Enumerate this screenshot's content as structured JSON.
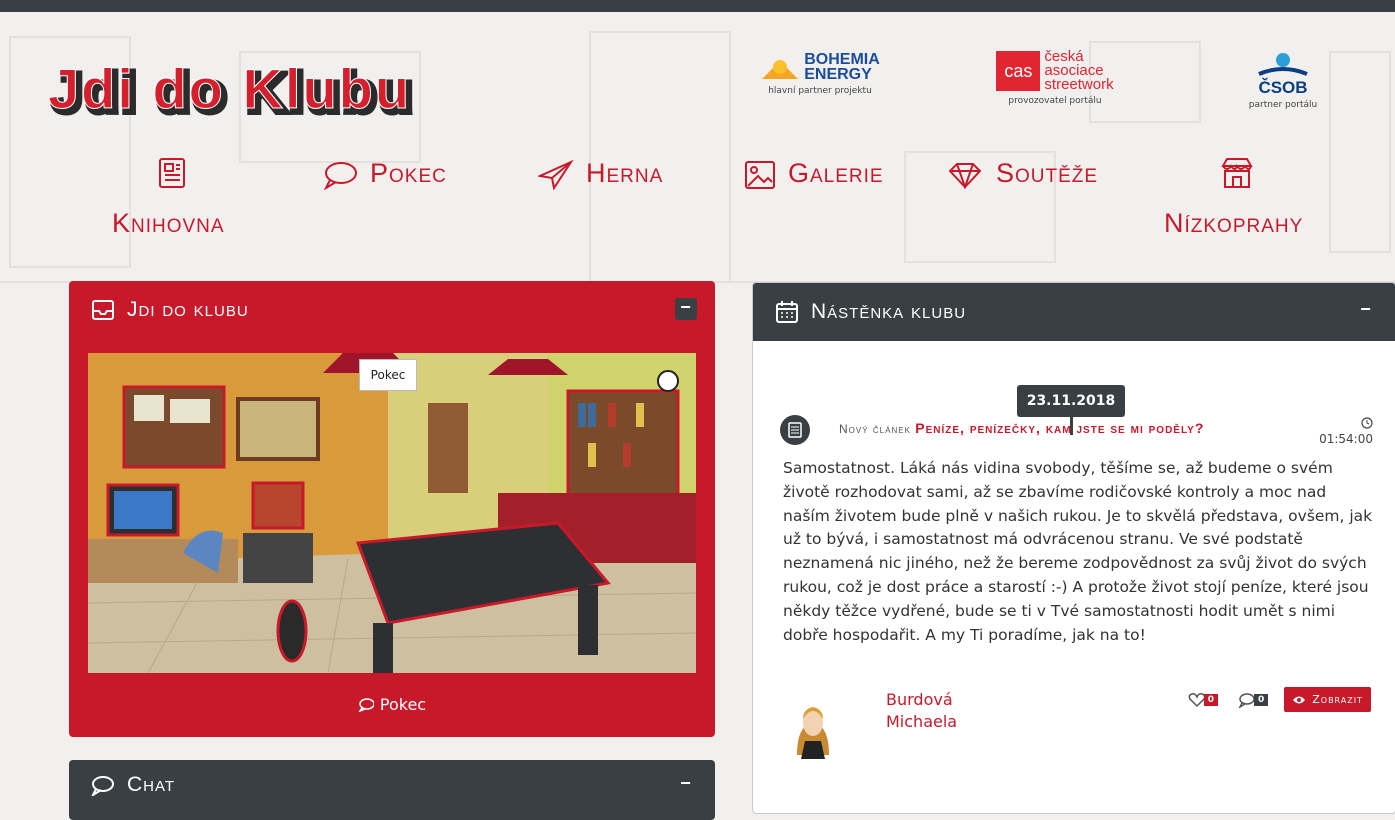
{
  "logo": {
    "text": "Jdi do Klubu"
  },
  "partners": [
    {
      "name_line1": "BOHEMIA",
      "name_line2": "ENERGY",
      "caption": "hlavní partner projektu",
      "color": "#1c4d9b"
    },
    {
      "mark": "cas",
      "name_line1": "česká",
      "name_line2": "asociace",
      "name_line3": "streetwork",
      "caption": "provozovatel portálu",
      "color": "#e12631"
    },
    {
      "name_line1": "ČSOB",
      "caption": "partner portálu",
      "color": "#0b3e82"
    }
  ],
  "nav": [
    {
      "label": "Knihovna",
      "icon": "newspaper-icon"
    },
    {
      "label": "Pokec",
      "icon": "speech-bubble-icon"
    },
    {
      "label": "Herna",
      "icon": "paper-plane-icon"
    },
    {
      "label": "Galerie",
      "icon": "picture-icon"
    },
    {
      "label": "Soutěže",
      "icon": "diamond-icon"
    },
    {
      "label": "Nízkoprahy",
      "icon": "shop-icon"
    }
  ],
  "club_panel": {
    "title": "Jdi do klubu",
    "collapse": "−",
    "tooltip": "Pokec",
    "footer_label": "Pokec"
  },
  "chat_panel": {
    "title": "Chat",
    "collapse": "−"
  },
  "board_panel": {
    "title": "Nástěnka klubu",
    "collapse": "−",
    "date": "23.11.2018",
    "article_prefix": "Nový článek",
    "article_title": "Peníze, penízečky, kam jste se mi poděly?",
    "time": "01:54:00",
    "text": "Samostatnost. Láká nás vidina svobody, těšíme se, až budeme o svém životě rozhodovat sami, až se zbavíme rodičovské kontroly a moc nad naším životem bude plně v našich rukou. Je to skvělá představa, ovšem, jak už to bývá, i samostatnost má odvrácenou stranu. Ve své podstatě neznamená nic jiného, než že bereme zodpovědnost za svůj život do svých rukou, což je dost práce a starostí :-) A protože život stojí peníze, které jsou někdy těžce vydřené, bude se ti v Tvé samostatnosti hodit umět s nimi dobře hospodařit. A my Ti poradíme, jak na to!",
    "author_first": "Burdová",
    "author_last": "Michaela",
    "likes": "0",
    "comments": "0",
    "view_label": "Zobrazit"
  },
  "colors": {
    "accent": "#c8192b",
    "dark": "#3a3f43",
    "background": "#f1f0ef"
  }
}
